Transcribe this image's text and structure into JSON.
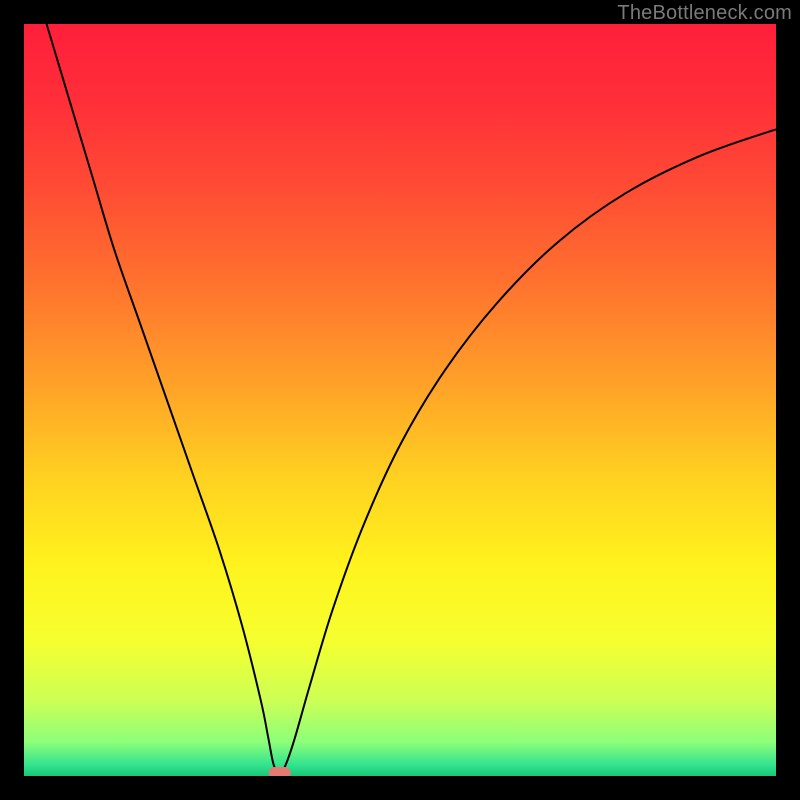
{
  "watermark": "TheBottleneck.com",
  "chart_data": {
    "type": "line",
    "title": "",
    "xlabel": "",
    "ylabel": "",
    "xlim": [
      0,
      100
    ],
    "ylim": [
      0,
      100
    ],
    "grid": false,
    "legend": false,
    "background_gradient_stops": [
      {
        "offset": 0.0,
        "color": "#ff1f3a"
      },
      {
        "offset": 0.1,
        "color": "#ff2e39"
      },
      {
        "offset": 0.22,
        "color": "#ff4c34"
      },
      {
        "offset": 0.35,
        "color": "#ff742e"
      },
      {
        "offset": 0.48,
        "color": "#ffa228"
      },
      {
        "offset": 0.6,
        "color": "#ffd021"
      },
      {
        "offset": 0.72,
        "color": "#fff31d"
      },
      {
        "offset": 0.82,
        "color": "#f6ff2f"
      },
      {
        "offset": 0.9,
        "color": "#ccff55"
      },
      {
        "offset": 0.955,
        "color": "#8cff7a"
      },
      {
        "offset": 0.985,
        "color": "#34e38f"
      },
      {
        "offset": 1.0,
        "color": "#18c877"
      }
    ],
    "optimum_marker": {
      "x": 34,
      "y": 0,
      "color": "#e67a72"
    },
    "series": [
      {
        "name": "bottleneck-curve",
        "color": "#000000",
        "stroke_width": 2,
        "points": [
          {
            "x": 3,
            "y": 100
          },
          {
            "x": 6,
            "y": 90
          },
          {
            "x": 9,
            "y": 80
          },
          {
            "x": 12,
            "y": 70
          },
          {
            "x": 15.5,
            "y": 60
          },
          {
            "x": 19,
            "y": 50
          },
          {
            "x": 22.5,
            "y": 40
          },
          {
            "x": 26,
            "y": 30
          },
          {
            "x": 29,
            "y": 20
          },
          {
            "x": 31.5,
            "y": 10
          },
          {
            "x": 32.5,
            "y": 5
          },
          {
            "x": 33.2,
            "y": 1.5
          },
          {
            "x": 34,
            "y": 0.3
          },
          {
            "x": 34.8,
            "y": 1.5
          },
          {
            "x": 36,
            "y": 5
          },
          {
            "x": 38,
            "y": 12
          },
          {
            "x": 41,
            "y": 22
          },
          {
            "x": 45,
            "y": 33
          },
          {
            "x": 50,
            "y": 44
          },
          {
            "x": 56,
            "y": 54
          },
          {
            "x": 63,
            "y": 63
          },
          {
            "x": 71,
            "y": 71
          },
          {
            "x": 80,
            "y": 77.5
          },
          {
            "x": 90,
            "y": 82.5
          },
          {
            "x": 100,
            "y": 86
          }
        ]
      }
    ]
  }
}
